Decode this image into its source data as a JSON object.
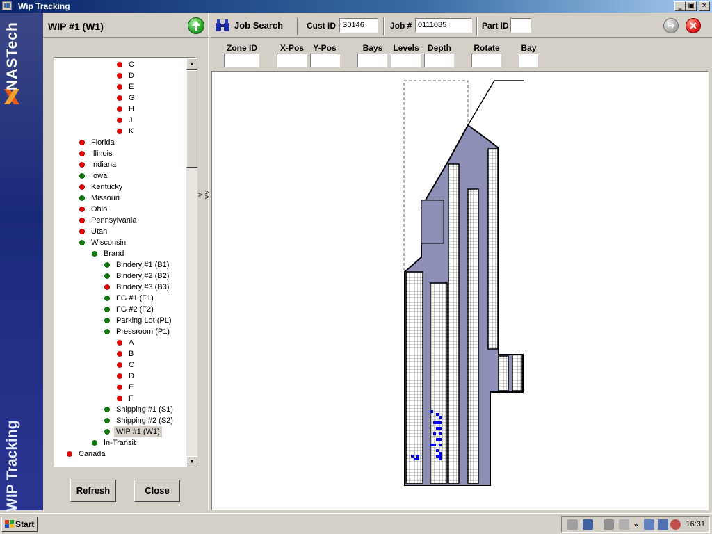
{
  "window": {
    "title": "Wip Tracking",
    "min_label": "_",
    "max_label": "▣",
    "close_label": "✕"
  },
  "brand": {
    "logo_text": "NASTech",
    "side_title": "WIP Tracking"
  },
  "left_panel": {
    "title": "WIP #1 (W1)",
    "refresh_label": "Refresh",
    "close_label": "Close",
    "splitter_label": "A A A",
    "tree": [
      {
        "label": "C",
        "status": "red",
        "level": 4
      },
      {
        "label": "D",
        "status": "red",
        "level": 4
      },
      {
        "label": "E",
        "status": "red",
        "level": 4
      },
      {
        "label": "G",
        "status": "red",
        "level": 4
      },
      {
        "label": "H",
        "status": "red",
        "level": 4
      },
      {
        "label": "J",
        "status": "red",
        "level": 4
      },
      {
        "label": "K",
        "status": "red",
        "level": 4
      },
      {
        "label": "Florida",
        "status": "red",
        "level": 1
      },
      {
        "label": "Illinois",
        "status": "red",
        "level": 1
      },
      {
        "label": "Indiana",
        "status": "red",
        "level": 1
      },
      {
        "label": "Iowa",
        "status": "green",
        "level": 1
      },
      {
        "label": "Kentucky",
        "status": "red",
        "level": 1
      },
      {
        "label": "Missouri",
        "status": "green",
        "level": 1
      },
      {
        "label": "Ohio",
        "status": "red",
        "level": 1
      },
      {
        "label": "Pennsylvania",
        "status": "red",
        "level": 1
      },
      {
        "label": "Utah",
        "status": "red",
        "level": 1
      },
      {
        "label": "Wisconsin",
        "status": "green",
        "level": 1
      },
      {
        "label": "Brand",
        "status": "green",
        "level": 2
      },
      {
        "label": "Bindery #1 (B1)",
        "status": "green",
        "level": 3
      },
      {
        "label": "Bindery #2 (B2)",
        "status": "green",
        "level": 3
      },
      {
        "label": "Bindery #3 (B3)",
        "status": "red",
        "level": 3
      },
      {
        "label": "FG #1 (F1)",
        "status": "green",
        "level": 3
      },
      {
        "label": "FG #2 (F2)",
        "status": "green",
        "level": 3
      },
      {
        "label": "Parking Lot (PL)",
        "status": "green",
        "level": 3
      },
      {
        "label": "Pressroom (P1)",
        "status": "green",
        "level": 3
      },
      {
        "label": "A",
        "status": "red",
        "level": 4
      },
      {
        "label": "B",
        "status": "red",
        "level": 4
      },
      {
        "label": "C",
        "status": "red",
        "level": 4
      },
      {
        "label": "D",
        "status": "red",
        "level": 4
      },
      {
        "label": "E",
        "status": "red",
        "level": 4
      },
      {
        "label": "F",
        "status": "red",
        "level": 4
      },
      {
        "label": "Shipping #1 (S1)",
        "status": "green",
        "level": 3
      },
      {
        "label": "Shipping #2 (S2)",
        "status": "green",
        "level": 3
      },
      {
        "label": "WIP #1 (W1)",
        "status": "green",
        "level": 3,
        "selected": true
      },
      {
        "label": "In-Transit",
        "status": "green",
        "level": 2
      },
      {
        "label": "Canada",
        "status": "red",
        "level": 0
      }
    ]
  },
  "toolbar": {
    "job_search_label": "Job Search",
    "cust_id_label": "Cust ID",
    "cust_id_value": "S0146",
    "job_label": "Job #",
    "job_value": "0111085",
    "part_id_label": "Part ID",
    "part_id_value": ""
  },
  "fields": {
    "zone_id": "Zone ID",
    "x_pos": "X-Pos",
    "y_pos": "Y-Pos",
    "bays": "Bays",
    "levels": "Levels",
    "depth": "Depth",
    "rotate": "Rotate",
    "bay": "Bay"
  },
  "taskbar": {
    "start_label": "Start",
    "clock": "16:31"
  },
  "colors": {
    "floor": "#8e8fb6",
    "rack_grid": "#555555",
    "highlight": "#0000ff",
    "status_red": "#e00000",
    "status_green": "#107810"
  }
}
